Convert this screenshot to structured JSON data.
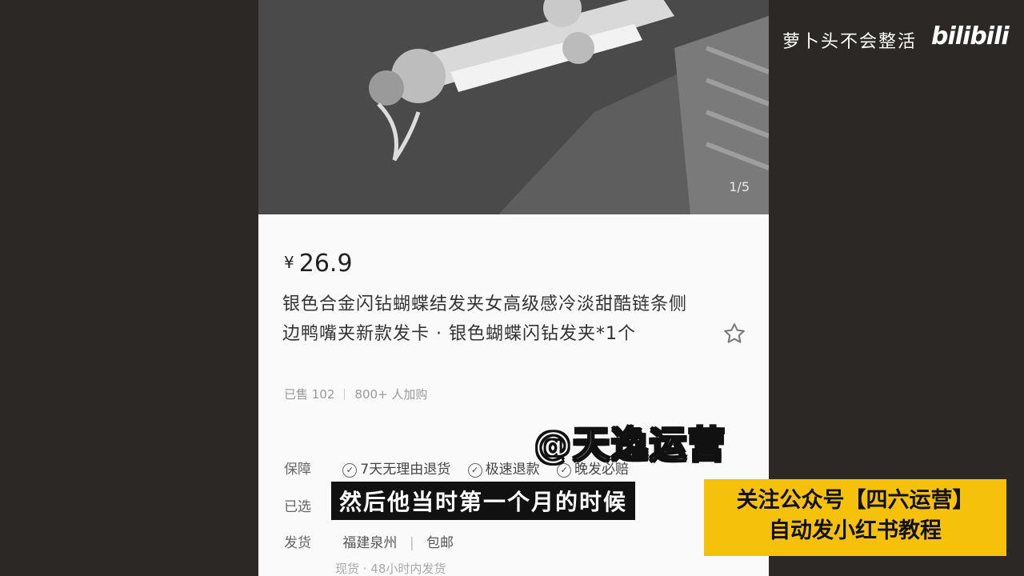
{
  "product": {
    "image_counter": "1/5",
    "currency": "¥",
    "price": "26.9",
    "title": "银色合金闪钻蝴蝶结发夹女高级感冷淡甜酷链条侧边鸭嘴夹新款发卡 · 银色蝴蝶闪钻发夹*1个",
    "sold": "已售 102",
    "carted": "800+ 人加购"
  },
  "rows": {
    "guarantee_label": "保障",
    "guarantee_tags": [
      "7天无理由退货",
      "极速退款",
      "晚发必赔"
    ],
    "selected_label": "已选",
    "shipping_label": "发货",
    "shipping_origin": "福建泉州",
    "shipping_free": "包邮",
    "shipping_sub": "现货 · 48小时内发货"
  },
  "overlay": {
    "watermark_text": "萝卜头不会整活",
    "bili_logo": "bilibili",
    "handle": "@天逸运营",
    "subtitle": "然后他当时第一个月的时候",
    "promo_line1": "关注公众号【四六运营】",
    "promo_line2": "自动发小红书教程"
  },
  "icons": {
    "favorite": "star-icon",
    "check": "check-circle-icon"
  },
  "colors": {
    "background": "#2b2825",
    "promo_bg": "#f5c10b"
  }
}
